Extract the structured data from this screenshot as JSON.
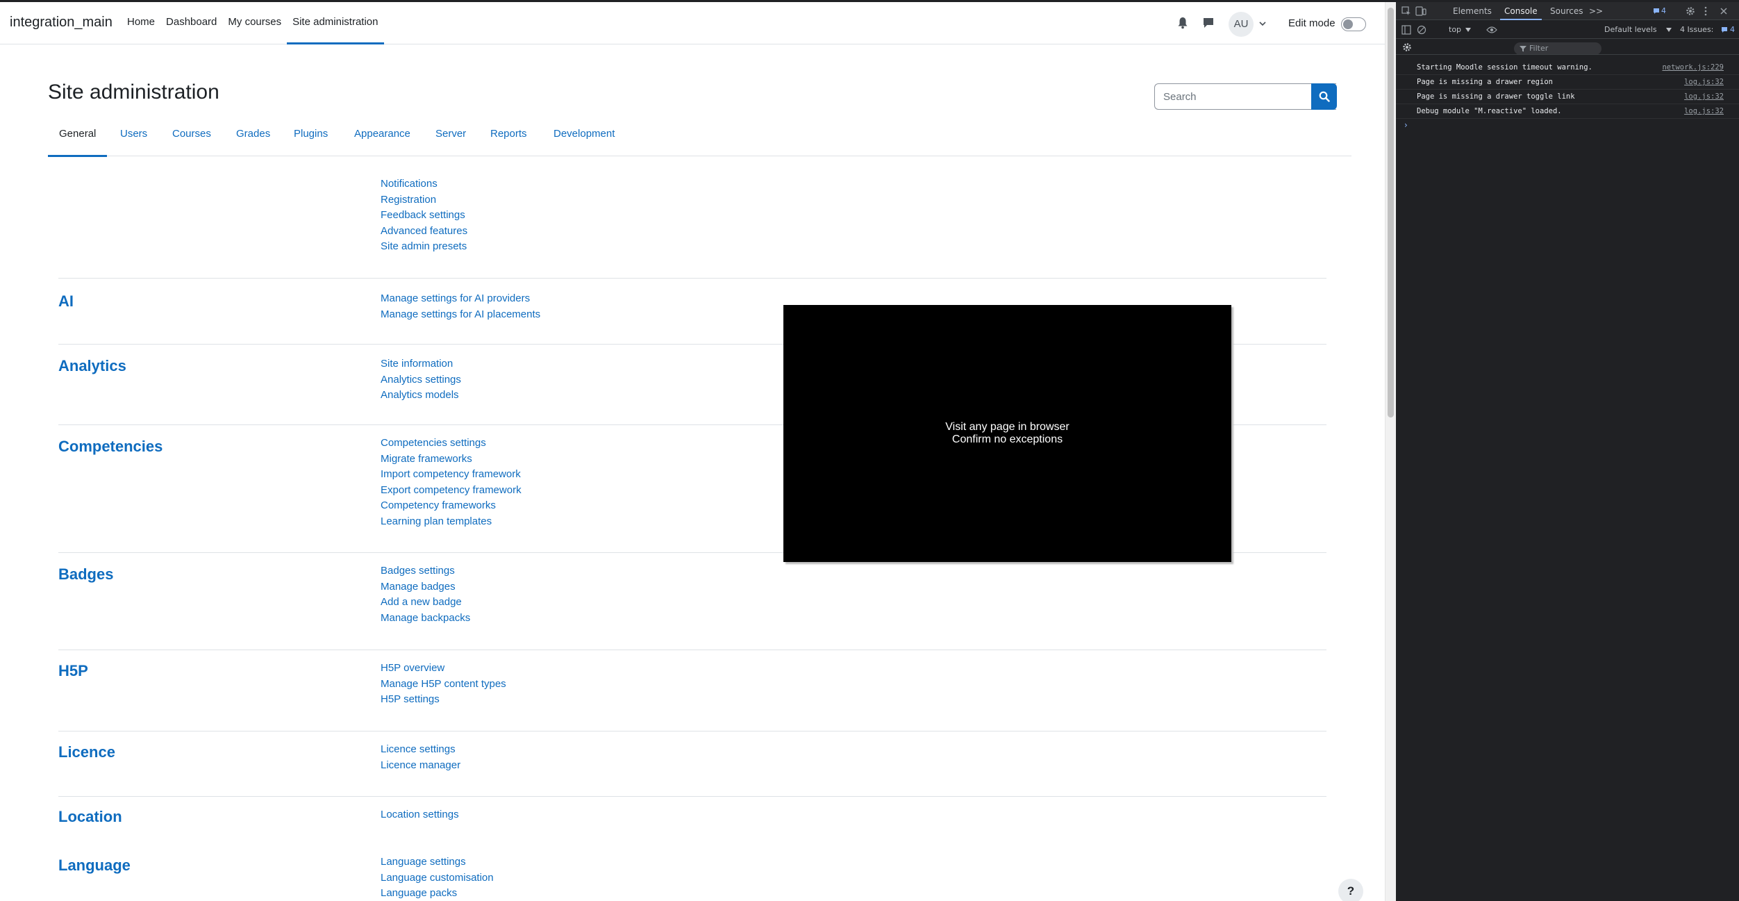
{
  "navbar": {
    "brand": "integration_main",
    "items": [
      {
        "label": "Home",
        "active": false
      },
      {
        "label": "Dashboard",
        "active": false
      },
      {
        "label": "My courses",
        "active": false
      },
      {
        "label": "Site administration",
        "active": true
      }
    ],
    "avatar_initials": "AU",
    "edit_mode_label": "Edit mode",
    "edit_mode_on": false
  },
  "page": {
    "title": "Site administration",
    "search_placeholder": "Search"
  },
  "tabs": [
    "General",
    "Users",
    "Courses",
    "Grades",
    "Plugins",
    "Appearance",
    "Server",
    "Reports",
    "Development"
  ],
  "active_tab": "General",
  "sections": [
    {
      "title": "",
      "links": [
        "Notifications",
        "Registration",
        "Feedback settings",
        "Advanced features",
        "Site admin presets"
      ]
    },
    {
      "title": "AI",
      "links": [
        "Manage settings for AI providers",
        "Manage settings for AI placements"
      ]
    },
    {
      "title": "Analytics",
      "links": [
        "Site information",
        "Analytics settings",
        "Analytics models"
      ]
    },
    {
      "title": "Competencies",
      "links": [
        "Competencies settings",
        "Migrate frameworks",
        "Import competency framework",
        "Export competency framework",
        "Competency frameworks",
        "Learning plan templates"
      ]
    },
    {
      "title": "Badges",
      "links": [
        "Badges settings",
        "Manage badges",
        "Add a new badge",
        "Manage backpacks"
      ]
    },
    {
      "title": "H5P",
      "links": [
        "H5P overview",
        "Manage H5P content types",
        "H5P settings"
      ]
    },
    {
      "title": "Licence",
      "links": [
        "Licence settings",
        "Licence manager"
      ]
    },
    {
      "title": "Location",
      "links": [
        "Location settings"
      ]
    },
    {
      "title": "Language",
      "links": [
        "Language settings",
        "Language customisation",
        "Language packs"
      ]
    }
  ],
  "help_label": "?",
  "overlay": {
    "line1": "Visit any page in browser",
    "line2": "Confirm no exceptions"
  },
  "devtools": {
    "tabs": [
      "Elements",
      "Console",
      "Sources"
    ],
    "active_tab": "Console",
    "more_tabs": ">>",
    "messages_badge": "4",
    "context": "top",
    "filter_placeholder": "Filter",
    "levels": "Default levels",
    "issues": "4 Issues:",
    "issues_count": "4",
    "console": [
      {
        "message": "Starting Moodle session timeout warning.",
        "source": "network.js:229"
      },
      {
        "message": "Page is missing a drawer region",
        "source": "log.js:32"
      },
      {
        "message": "Page is missing a drawer toggle link",
        "source": "log.js:32"
      },
      {
        "message": "Debug module \"M.reactive\" loaded.",
        "source": "log.js:32"
      }
    ],
    "prompt": "›"
  },
  "colors": {
    "link": "#0f6cbf",
    "devtools_bg": "#202124",
    "devtools_accent": "#8ab4f8"
  }
}
